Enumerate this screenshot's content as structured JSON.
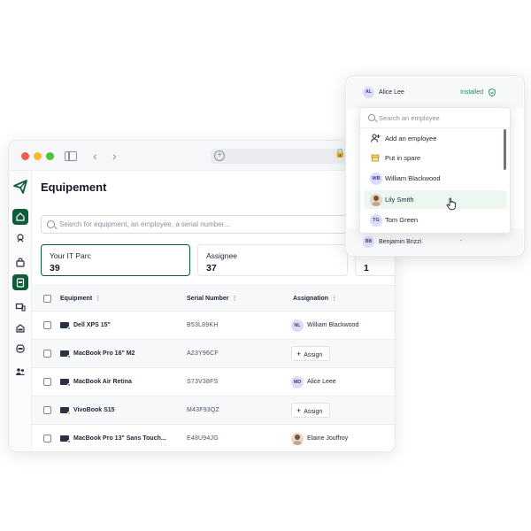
{
  "window": {
    "title": "Equipement",
    "search_placeholder": "Search for equipment, an employee, a serial number..."
  },
  "sidebar": {
    "items": [
      {
        "name": "home",
        "active": true
      },
      {
        "name": "tracking",
        "active": false
      },
      {
        "name": "bag",
        "active": false
      },
      {
        "name": "clipboard-pro",
        "active": true
      },
      {
        "name": "devices",
        "active": false
      },
      {
        "name": "badge-pro",
        "active": false
      },
      {
        "name": "badge-pro-2",
        "active": false
      },
      {
        "name": "team",
        "active": false
      }
    ]
  },
  "stats": [
    {
      "label": "Your IT Parc",
      "value": "39"
    },
    {
      "label": "Assignee",
      "value": "37"
    },
    {
      "label": "",
      "value": "1"
    }
  ],
  "table": {
    "columns": {
      "equipment": "Equipment",
      "serial": "Serial Number",
      "assignation": "Assignation"
    },
    "rows": [
      {
        "name": "Dell XPS 15\"",
        "serial": "B53L89KH",
        "assignee": "William Blackwood",
        "initials": "NL",
        "assign_label": "",
        "status_color": "#1f9d55"
      },
      {
        "name": "MacBook Pro 16\" M2",
        "serial": "A23Y96CF",
        "assignee": "",
        "initials": "",
        "assign_label": "Assign",
        "status_color": "#1f9d55"
      },
      {
        "name": "MacBook Air Retina",
        "serial": "S73V38FS",
        "assignee": "Alice Leee",
        "initials": "MD",
        "assign_label": "",
        "status_color": "#3b6fe0"
      },
      {
        "name": "VivoBook S15",
        "serial": "M43F93QZ",
        "assignee": "",
        "initials": "",
        "assign_label": "Assign",
        "status_color": "#f08c2e"
      },
      {
        "name": "MacBook Pro 13\" Sans Touch...",
        "serial": "E48U94JG",
        "assignee": "Elaine Jouffroy",
        "initials": "",
        "assign_label": "",
        "status_color": "#e0424a"
      }
    ]
  },
  "panel": {
    "top": {
      "initials": "AL",
      "name": "Alice Lee",
      "status": "Installed"
    },
    "bottom": {
      "initials": "BB",
      "name": "Benjamin Brizzi",
      "status": "-"
    }
  },
  "dropdown": {
    "search_placeholder": "Search an employee",
    "items": [
      {
        "label": "Add an employee",
        "icon": "add-user-icon"
      },
      {
        "label": "Put in spare",
        "icon": "box-icon"
      },
      {
        "label": "William Blackwood",
        "initials": "WB"
      },
      {
        "label": "Lily Smith",
        "photo": true
      },
      {
        "label": "Tom Green",
        "initials": "TG"
      }
    ]
  },
  "colors": {
    "brand": "#0f5b3a",
    "installed": "#1f8a55",
    "avatar_bg": "#dcdcf8",
    "hover_bg": "#ebf7ef"
  }
}
